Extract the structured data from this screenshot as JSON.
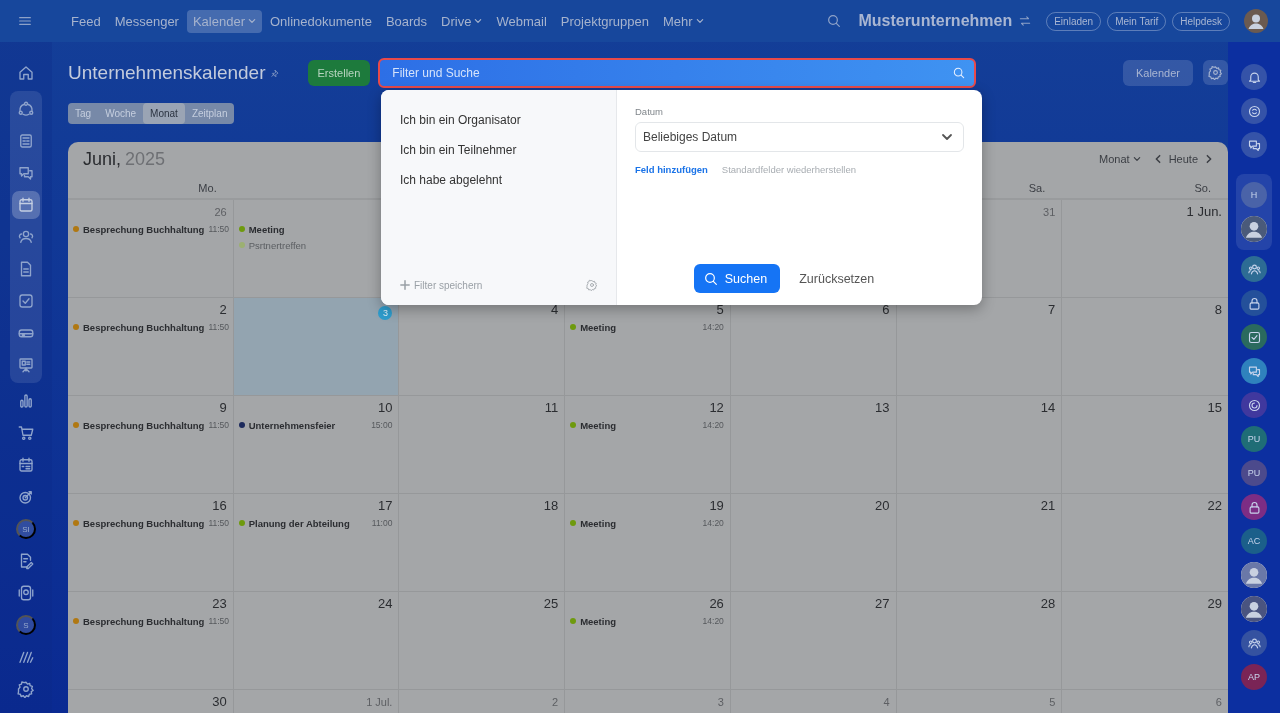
{
  "top_nav": {
    "items": [
      {
        "label": "Feed",
        "selected": false,
        "dropdown": false
      },
      {
        "label": "Messenger",
        "selected": false,
        "dropdown": false
      },
      {
        "label": "Kalender",
        "selected": true,
        "dropdown": true
      },
      {
        "label": "Onlinedokumente",
        "selected": false,
        "dropdown": false
      },
      {
        "label": "Boards",
        "selected": false,
        "dropdown": false
      },
      {
        "label": "Drive",
        "selected": false,
        "dropdown": true
      },
      {
        "label": "Webmail",
        "selected": false,
        "dropdown": false
      },
      {
        "label": "Projektgruppen",
        "selected": false,
        "dropdown": false
      },
      {
        "label": "Mehr",
        "selected": false,
        "dropdown": true
      }
    ],
    "company": "Musterunternehmen",
    "buttons": [
      "Einladen",
      "Mein Tarif",
      "Helpdesk"
    ]
  },
  "left_sidebar": {
    "sections": [
      {
        "boxed": false,
        "items": [
          {
            "kind": "home",
            "selected": false
          }
        ]
      },
      {
        "boxed": true,
        "items": [
          {
            "kind": "cycle",
            "selected": false
          },
          {
            "kind": "news",
            "selected": false
          },
          {
            "kind": "chat",
            "selected": false
          },
          {
            "kind": "calendar",
            "selected": true
          },
          {
            "kind": "people",
            "selected": false
          },
          {
            "kind": "doc",
            "selected": false
          },
          {
            "kind": "task",
            "selected": false
          },
          {
            "kind": "drive",
            "selected": false
          },
          {
            "kind": "board",
            "selected": false
          }
        ]
      },
      {
        "boxed": false,
        "items": [
          {
            "kind": "chart",
            "selected": false
          },
          {
            "kind": "cart",
            "selected": false
          },
          {
            "kind": "schedule",
            "selected": false
          },
          {
            "kind": "target",
            "selected": false
          },
          {
            "kind": "initials",
            "initials": "SI",
            "selected": false
          },
          {
            "kind": "edit",
            "selected": false
          },
          {
            "kind": "device",
            "selected": false
          },
          {
            "kind": "initials",
            "initials": "S",
            "selected": false
          },
          {
            "kind": "stripes",
            "selected": false
          },
          {
            "kind": "gear",
            "selected": false
          }
        ]
      }
    ]
  },
  "header": {
    "title": "Unternehmenskalender",
    "create_button": "Erstellen",
    "search": {
      "placeholder": "Filter und Suche",
      "focused": true
    },
    "calendar_button": "Kalender"
  },
  "view_tabs": [
    {
      "label": "Tag",
      "selected": false
    },
    {
      "label": "Woche",
      "selected": false
    },
    {
      "label": "Monat",
      "selected": true
    },
    {
      "label": "Zeitplan",
      "selected": false
    }
  ],
  "calendar": {
    "month": "Juni,",
    "year": "2025",
    "view_select": "Monat",
    "today_button": "Heute",
    "day_headers": {
      "left": [
        "Mo."
      ],
      "right": [
        "Sa.",
        "So."
      ]
    },
    "weeks": [
      {
        "left": [
          {
            "date": "26",
            "other_month": true,
            "today": false,
            "events": [
              {
                "title": "Besprechung Buchhaltung",
                "time": "11:50",
                "color": "#b07812",
                "muted": false
              }
            ]
          },
          {
            "today": false,
            "events": [
              {
                "title": "Meeting",
                "color": "#6e9a0e",
                "muted": false
              },
              {
                "title": "Psrtnertreffen",
                "color": "#9cb072",
                "muted": true
              }
            ]
          }
        ],
        "right": [
          {
            "date": "31",
            "other_month": true,
            "today": false
          },
          {
            "date": "1 Jun.",
            "other_month": false,
            "today": false
          }
        ]
      },
      [
        {
          "date": "2",
          "other_month": false,
          "today": false,
          "events": [
            {
              "title": "Besprechung Buchhaltung",
              "time": "11:50",
              "color": "#b07812",
              "muted": false
            }
          ]
        },
        {
          "date": "3",
          "other_month": false,
          "today": true
        },
        {
          "date": "4",
          "other_month": false,
          "today": false
        },
        {
          "date": "5",
          "other_month": false,
          "today": false,
          "events": [
            {
              "title": "Meeting",
              "time": "14:20",
              "color": "#6e9a0e",
              "muted": false
            }
          ]
        },
        {
          "date": "6",
          "other_month": false,
          "today": false
        },
        {
          "date": "7",
          "other_month": false,
          "today": false
        },
        {
          "date": "8",
          "other_month": false,
          "today": false
        }
      ],
      [
        {
          "date": "9",
          "other_month": false,
          "today": false,
          "events": [
            {
              "title": "Besprechung Buchhaltung",
              "time": "11:50",
              "color": "#b07812",
              "muted": false
            }
          ]
        },
        {
          "date": "10",
          "other_month": false,
          "today": false,
          "events": [
            {
              "title": "Unternehmensfeier",
              "time": "15:00",
              "color": "#1c2a5c",
              "muted": false
            }
          ]
        },
        {
          "date": "11",
          "other_month": false,
          "today": false
        },
        {
          "date": "12",
          "other_month": false,
          "today": false,
          "events": [
            {
              "title": "Meeting",
              "time": "14:20",
              "color": "#6e9a0e",
              "muted": false
            }
          ]
        },
        {
          "date": "13",
          "other_month": false,
          "today": false
        },
        {
          "date": "14",
          "other_month": false,
          "today": false
        },
        {
          "date": "15",
          "other_month": false,
          "today": false
        }
      ],
      [
        {
          "date": "16",
          "other_month": false,
          "today": false,
          "events": [
            {
              "title": "Besprechung Buchhaltung",
              "time": "11:50",
              "color": "#b07812",
              "muted": false
            }
          ]
        },
        {
          "date": "17",
          "other_month": false,
          "today": false,
          "events": [
            {
              "title": "Planung der Abteilung",
              "time": "11:00",
              "color": "#6e9a0e",
              "muted": false
            }
          ]
        },
        {
          "date": "18",
          "other_month": false,
          "today": false
        },
        {
          "date": "19",
          "other_month": false,
          "today": false,
          "events": [
            {
              "title": "Meeting",
              "time": "14:20",
              "color": "#6e9a0e",
              "muted": false
            }
          ]
        },
        {
          "date": "20",
          "other_month": false,
          "today": false
        },
        {
          "date": "21",
          "other_month": false,
          "today": false
        },
        {
          "date": "22",
          "other_month": false,
          "today": false
        }
      ],
      [
        {
          "date": "23",
          "other_month": false,
          "today": false,
          "events": [
            {
              "title": "Besprechung Buchhaltung",
              "time": "11:50",
              "color": "#b07812",
              "muted": false
            }
          ]
        },
        {
          "date": "24",
          "other_month": false,
          "today": false
        },
        {
          "date": "25",
          "other_month": false,
          "today": false
        },
        {
          "date": "26",
          "other_month": false,
          "today": false,
          "events": [
            {
              "title": "Meeting",
              "time": "14:20",
              "color": "#6e9a0e",
              "muted": false
            }
          ]
        },
        {
          "date": "27",
          "other_month": false,
          "today": false
        },
        {
          "date": "28",
          "other_month": false,
          "today": false
        },
        {
          "date": "29",
          "other_month": false,
          "today": false
        }
      ],
      [
        {
          "date": "30",
          "other_month": false,
          "today": false
        },
        {
          "date": "1 Jul.",
          "other_month": true,
          "today": false
        },
        {
          "date": "2",
          "other_month": true,
          "today": false
        },
        {
          "date": "3",
          "other_month": true,
          "today": false
        },
        {
          "date": "4",
          "other_month": true,
          "today": false
        },
        {
          "date": "5",
          "other_month": true,
          "today": false
        },
        {
          "date": "6",
          "other_month": true,
          "today": false
        }
      ]
    ]
  },
  "filter_popup": {
    "presets": [
      {
        "label": "Ich bin ein Organisator",
        "selected": false
      },
      {
        "label": "Ich bin ein Teilnehmer",
        "selected": false
      },
      {
        "label": "Ich habe abgelehnt",
        "selected": false
      }
    ],
    "save_filter": "Filter speichern",
    "field_label": "Datum",
    "field_value": "Beliebiges Datum",
    "add_field": "Feld hinzufügen",
    "restore_fields": "Standardfelder wiederherstellen",
    "search_button": "Suchen",
    "reset_button": "Zurücksetzen"
  },
  "right_sidebar": {
    "sections": [
      {
        "boxed": false,
        "items": [
          {
            "kind": "bell",
            "color": "#3553a8"
          },
          {
            "kind": "sync",
            "color": "#3553a8"
          },
          {
            "kind": "chat",
            "color": "#3553a8"
          }
        ]
      },
      {
        "boxed": true,
        "items": [
          {
            "kind": "initials",
            "initials": "H",
            "color": "#4a63a8"
          },
          {
            "kind": "avatar",
            "color": "#4a5a7a"
          }
        ]
      },
      {
        "boxed": false,
        "items": [
          {
            "kind": "group",
            "color": "#2d6c94"
          },
          {
            "kind": "lock",
            "color": "#24509a"
          },
          {
            "kind": "task",
            "color": "#2a6a5e"
          },
          {
            "kind": "chat",
            "color": "#2f82bd"
          },
          {
            "kind": "spiral",
            "color": "#40389e"
          },
          {
            "kind": "initials",
            "initials": "PU",
            "color": "#1f6d76"
          },
          {
            "kind": "initials",
            "initials": "PU",
            "color": "#4c4a8c"
          },
          {
            "kind": "lock",
            "color": "#7c2d84"
          },
          {
            "kind": "initials",
            "initials": "AC",
            "color": "#1b5f8a"
          },
          {
            "kind": "avatar",
            "color": "#6a78a8"
          },
          {
            "kind": "avatar",
            "color": "#4a5480"
          },
          {
            "kind": "group",
            "color": "#3552a0"
          },
          {
            "kind": "initials",
            "initials": "AP",
            "color": "#7a2456"
          }
        ]
      }
    ]
  }
}
